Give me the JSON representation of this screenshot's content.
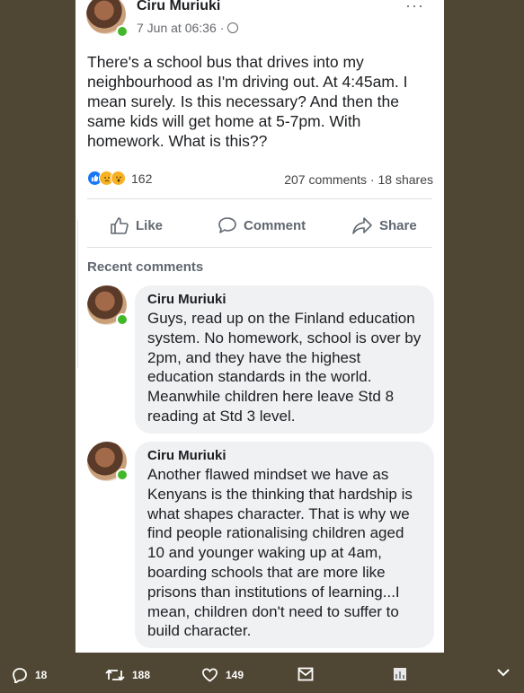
{
  "post": {
    "author": "Ciru Muriuki",
    "time": "7 Jun at 06:36",
    "separator": "·",
    "more": "···",
    "text": "There's a school bus that drives into my neighbourhood as I'm  driving out. At 4:45am. I mean surely. Is this necessary? And then the same kids will get home at 5-7pm. With homework. What is this??",
    "reaction_count": "162",
    "comments_count": "207 comments",
    "shares_count": "18 shares",
    "actions": {
      "like": "Like",
      "comment": "Comment",
      "share": "Share"
    },
    "reactions": [
      "like-icon",
      "sad-icon",
      "wow-icon"
    ]
  },
  "recent_label": "Recent comments",
  "comments": [
    {
      "author": "Ciru Muriuki",
      "text": "Guys, read up on the Finland education system. No homework, school is over by 2pm, and they have the highest education standards in the world. Meanwhile children here leave Std 8 reading at Std 3 level."
    },
    {
      "author": "Ciru Muriuki",
      "text": "Another flawed mindset we have as Kenyans is the thinking that hardship is what shapes character. That is why we find people rationalising children aged 10 and younger waking up at 4am, boarding schools that are more like prisons than institutions of learning...I mean, children don't need to suffer to build character."
    }
  ],
  "tweet_bar": {
    "replies": "18",
    "retweets": "188",
    "likes": "149"
  },
  "colors": {
    "background": "#4f4633",
    "online": "#42b72a",
    "like_blue": "#1877f2"
  }
}
